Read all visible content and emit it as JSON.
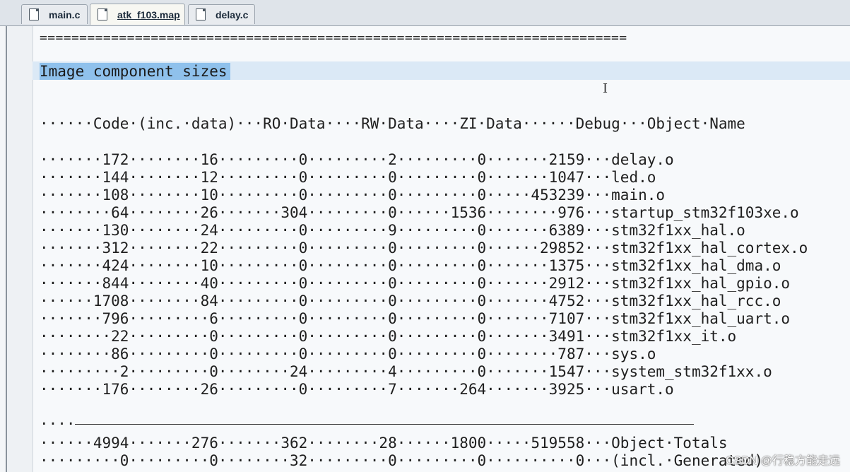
{
  "tabs": [
    {
      "label": "main.c"
    },
    {
      "label": "atk_f103.map"
    },
    {
      "label": "delay.c"
    }
  ],
  "editor": {
    "separator": "==========================================================================",
    "section_title": "Image component sizes",
    "header": "······Code·(inc.·data)···RO·Data····RW·Data····ZI·Data······Debug···Object·Name",
    "rows": [
      "·······172········16·········0·········2·········0·······2159···delay.o",
      "·······144········12·········0·········0·········0·······1047···led.o",
      "·······108········10·········0·········0·········0·····453239···main.o",
      "········64········26·······304·········0······1536········976···startup_stm32f103xe.o",
      "·······130········24·········0·········9·········0·······6389···stm32f1xx_hal.o",
      "·······312········22·········0·········0·········0······29852···stm32f1xx_hal_cortex.o",
      "·······424········10·········0·········0·········0·······1375···stm32f1xx_hal_dma.o",
      "·······844········40·········0·········0·········0·······2912···stm32f1xx_hal_gpio.o",
      "······1708········84·········0·········0·········0·······4752···stm32f1xx_hal_rcc.o",
      "·······796·········6·········0·········0·········0·······7107···stm32f1xx_hal_uart.o",
      "········22·········0·········0·········0·········0·······3491···stm32f1xx_it.o",
      "········86·········0·········0·········0·········0········787···sys.o",
      "·········2·········0········24·········4·········0·······1547···system_stm32f1xx.o",
      "·······176········26·········0·········7·······264·······3925···usart.o"
    ],
    "rule_prefix": "····",
    "totals": "······4994·······276·······362········28······1800·····519558···Object·Totals",
    "generated": "·········0·········0········32·········0·········0··········0···(incl.·Generated)"
  },
  "watermark": "CSDN @行稳方能走远"
}
